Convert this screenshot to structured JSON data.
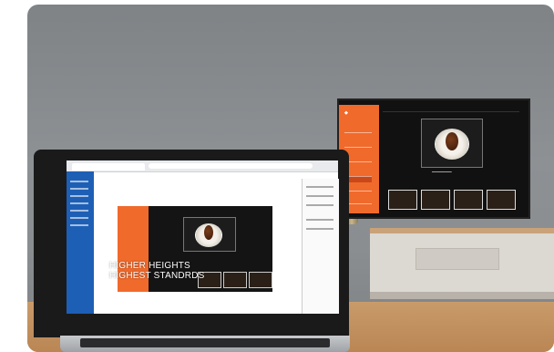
{
  "overlay": {
    "line1": "HIGHER HEIGHTS",
    "line2": "HIGHEST STANDRDS"
  },
  "icons": {
    "tv": "tv-display-icon",
    "laptop": "laptop-icon",
    "dish": "plated-dish-icon"
  },
  "colors": {
    "brand_orange": "#f06a2c",
    "app_blue": "#1e5fb6",
    "wall_gray": "#8a8e91"
  }
}
